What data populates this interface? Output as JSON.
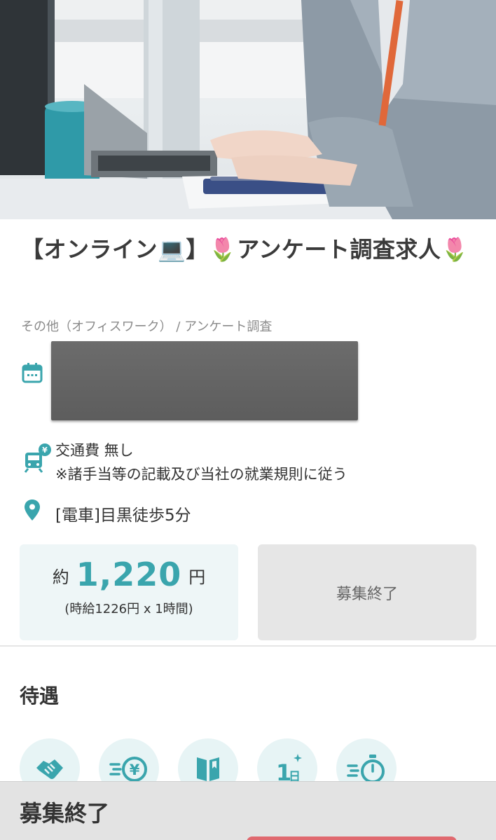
{
  "job": {
    "title": "【オンライン💻】🌷アンケート調査求人🌷",
    "category": "その他（オフィスワーク） / アンケート調査"
  },
  "transport": {
    "line1": "交通費 無し",
    "line2": "※諸手当等の記載及び当社の就業規則に従う"
  },
  "access": {
    "station": "[電車]目黒徒歩5分"
  },
  "wage": {
    "prefix": "約",
    "amount": "1,220",
    "unit": "円",
    "detail": "(時給1226円 x 1時間)"
  },
  "apply_button": {
    "label": "募集終了"
  },
  "benefits": {
    "section_title": "待遇",
    "icons": [
      "handshake-icon",
      "yen-transfer-icon",
      "book-icon",
      "one-day-icon",
      "stopwatch-icon"
    ]
  },
  "footer": {
    "status": "募集終了"
  },
  "colors": {
    "accent": "#3aa5ad",
    "benefit_bg": "#e7f4f5",
    "wage_bg": "#eef6f7",
    "closed_bg": "#e6e6e6",
    "footer_accent": "#e0696f"
  }
}
